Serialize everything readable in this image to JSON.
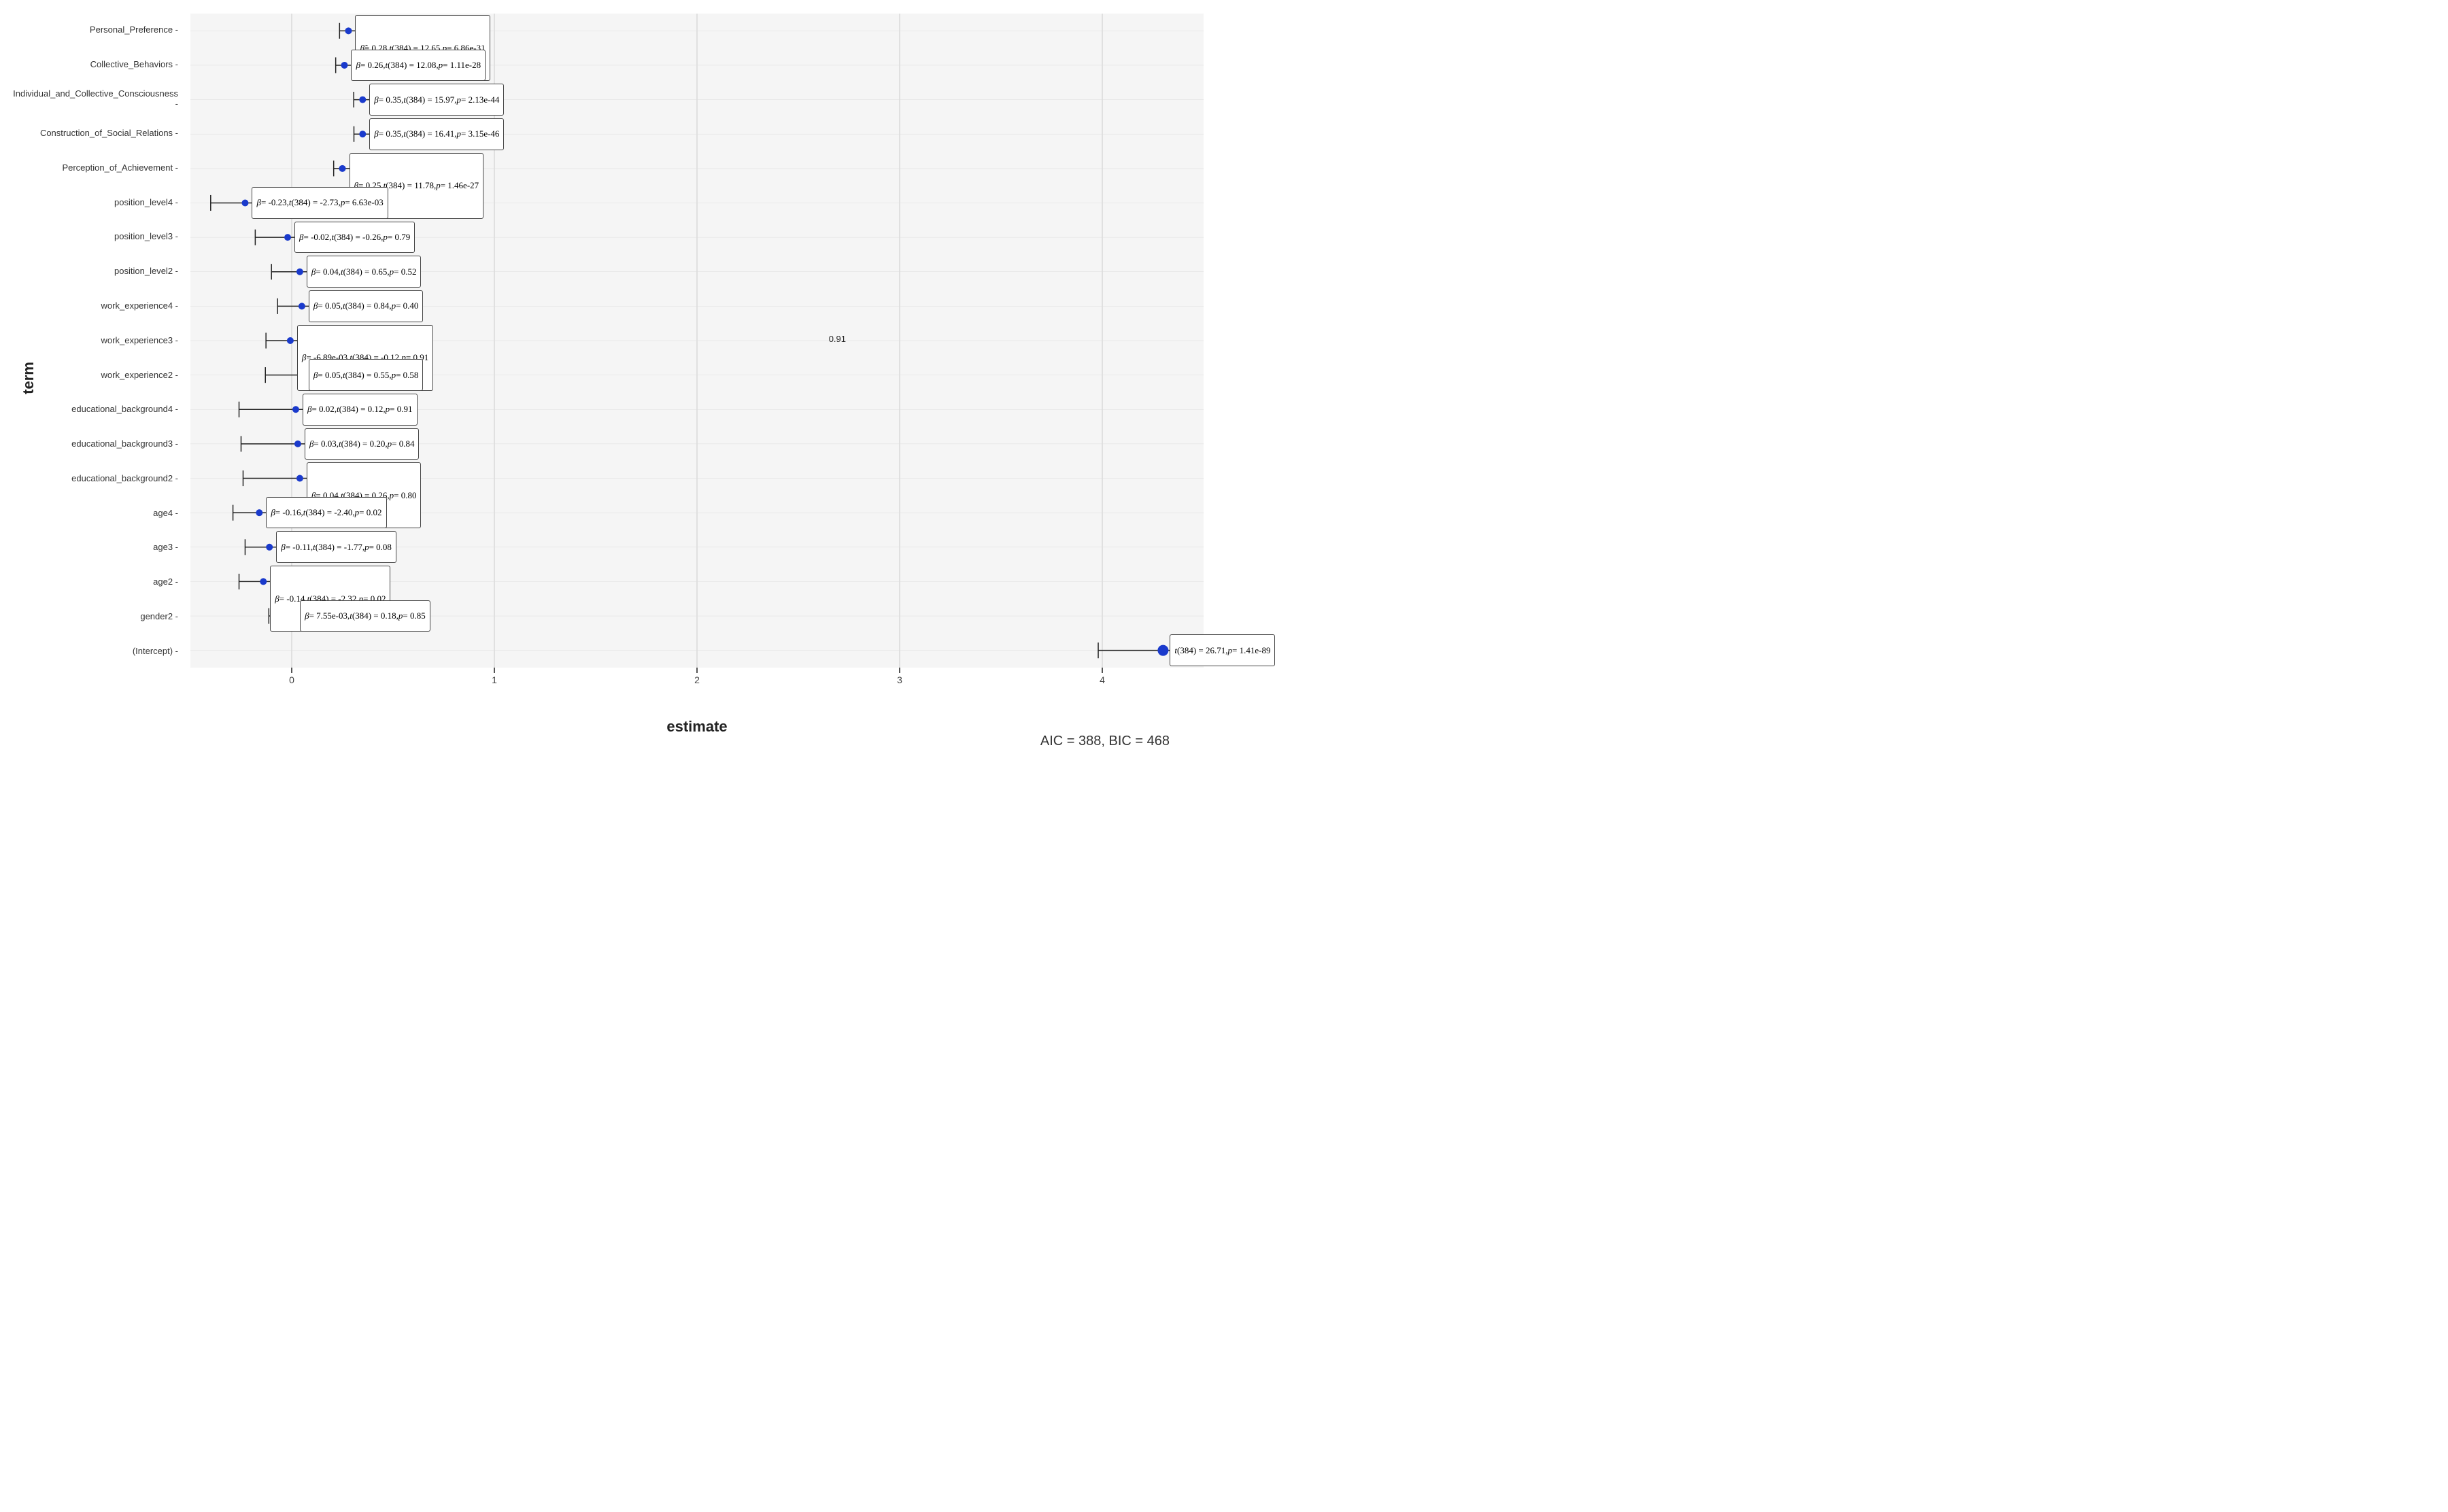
{
  "chart": {
    "y_axis_label": "term",
    "x_axis_label": "estimate",
    "aic_bic": "AIC = 388, BIC = 468",
    "terms": [
      "Personal_Preference",
      "Collective_Behaviors",
      "Individual_and_Collective_Consciousness",
      "Construction_of_Social_Relations",
      "Perception_of_Achievement",
      "position_level4",
      "position_level3",
      "position_level2",
      "work_experience4",
      "work_experience3",
      "work_experience2",
      "educational_background4",
      "educational_background3",
      "educational_background2",
      "age4",
      "age3",
      "age2",
      "gender2",
      "(Intercept)"
    ],
    "tooltips": [
      {
        "term": "Personal_Preference",
        "text": "β̂ = 0.28, t(384) = 12.65, p = 6.86e-31",
        "hat": true
      },
      {
        "term": "Collective_Behaviors",
        "text": "β = 0.26, t(384) = 12.08, p = 1.11e-28"
      },
      {
        "term": "Individual_and_Collective_Consciousness",
        "text": "β = 0.35, t(384) = 15.97, p = 2.13e-44"
      },
      {
        "term": "Construction_of_Social_Relations",
        "text": "β = 0.35, t(384) = 16.41, p = 3.15e-46"
      },
      {
        "term": "Perception_of_Achievement",
        "text": "β = 0.25, t(384) = 11.78, p = 1.46e-27"
      },
      {
        "term": "position_level4",
        "text": "β = -0.23, t(384) = -2.73, p = 6.63e-03"
      },
      {
        "term": "position_level3",
        "text": "β = -0.02, t(384) = -0.26, p = 0.79"
      },
      {
        "term": "position_level2",
        "text": "β = 0.04, t(384) = 0.65, p = 0.52"
      },
      {
        "term": "work_experience4",
        "text": "β = 0.05, t(384) = 0.84, p = 0.40"
      },
      {
        "term": "work_experience3",
        "text": "β = -6.89e-03, t(384) = -0.12, p = 0.91"
      },
      {
        "term": "work_experience2",
        "text": "β = 0.05, t(384) = 0.55, p = 0.58"
      },
      {
        "term": "educational_background4",
        "text": "β = 0.02, t(384) = 0.12, p = 0.91"
      },
      {
        "term": "educational_background3",
        "text": "β = 0.03, t(384) = 0.20, p = 0.84"
      },
      {
        "term": "educational_background2",
        "text": "β = 0.04, t(384) = 0.26, p = 0.80"
      },
      {
        "term": "age4",
        "text": "β = -0.16, t(384) = -2.40, p = 0.02"
      },
      {
        "term": "age3",
        "text": "β = -0.11, t(384) = -1.77, p = 0.08"
      },
      {
        "term": "age2",
        "text": "β = -0.14, t(384) = -2.32, p = 0.02"
      },
      {
        "term": "gender2",
        "text": "β = 7.55e-03, t(384) = 0.18, p = 0.85"
      },
      {
        "term": "(Intercept)",
        "text": "t(384) = 26.71, p = 1.41e-89"
      }
    ],
    "x_ticks": [
      0,
      1,
      2,
      3,
      4
    ],
    "x_min": -0.5,
    "x_max": 4.5,
    "intercept_estimate": 4.3
  }
}
